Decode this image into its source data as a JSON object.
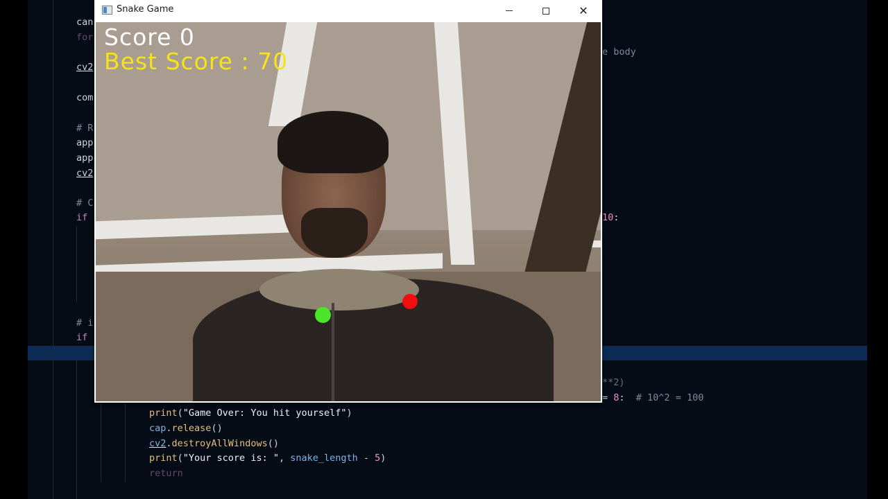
{
  "editor": {
    "lines": [
      {
        "id": "l1",
        "segments": [
          {
            "t": "can",
            "c": "plain"
          }
        ],
        "dim": false
      },
      {
        "id": "l2",
        "segments": [
          {
            "t": "for",
            "c": "kw"
          }
        ],
        "dim": true
      },
      {
        "id": "l3",
        "segments": [
          {
            "t": "e body",
            "c": "cm"
          }
        ],
        "dim": false
      },
      {
        "id": "l4",
        "segments": [
          {
            "t": "cv2",
            "c": "plain"
          }
        ],
        "dim": false
      },
      {
        "id": "l5",
        "segments": [
          {
            "t": "com",
            "c": "plain"
          }
        ],
        "dim": false
      },
      {
        "id": "l6",
        "segments": [
          {
            "t": "# R",
            "c": "cm"
          }
        ],
        "dim": false
      },
      {
        "id": "l7",
        "segments": [
          {
            "t": "app",
            "c": "plain"
          }
        ],
        "dim": false
      },
      {
        "id": "l8",
        "segments": [
          {
            "t": "app",
            "c": "plain"
          }
        ],
        "dim": false
      },
      {
        "id": "l9",
        "segments": [
          {
            "t": "cv2",
            "c": "plain"
          }
        ],
        "dim": false
      },
      {
        "id": "l10",
        "segments": [
          {
            "t": "# C",
            "c": "cm"
          }
        ],
        "dim": false
      },
      {
        "id": "l11",
        "segments": [
          {
            "t": "if",
            "c": "kw"
          }
        ],
        "dim": false
      },
      {
        "id": "l12",
        "segments": [
          {
            "t": "10",
            "c": "num"
          },
          {
            "t": ":",
            "c": "plain"
          }
        ],
        "dim": false
      },
      {
        "id": "l13",
        "segments": [
          {
            "t": "# i",
            "c": "cm"
          }
        ],
        "dim": false
      },
      {
        "id": "l14",
        "segments": [
          {
            "t": "if",
            "c": "kw"
          }
        ],
        "dim": false
      },
      {
        "id": "l15",
        "segments": [
          {
            "t": "**2)",
            "c": "plain"
          }
        ],
        "dim": true
      },
      {
        "id": "l16",
        "segments": [
          {
            "t": "= ",
            "c": "plain"
          },
          {
            "t": "8",
            "c": "num"
          },
          {
            "t": ":  ",
            "c": "plain"
          },
          {
            "t": "# 10^2 = 100",
            "c": "cm"
          }
        ],
        "dim": false
      },
      {
        "id": "l17",
        "segments": [
          {
            "t": "print",
            "c": "fn"
          },
          {
            "t": "(",
            "c": "plain"
          },
          {
            "t": "\"Game Over: You hit yourself\"",
            "c": "str"
          },
          {
            "t": ")",
            "c": "plain"
          }
        ],
        "dim": false
      },
      {
        "id": "l18",
        "segments": [
          {
            "t": "cap",
            "c": "obj"
          },
          {
            "t": ".",
            "c": "plain"
          },
          {
            "t": "release",
            "c": "fn"
          },
          {
            "t": "()",
            "c": "plain"
          }
        ],
        "dim": false
      },
      {
        "id": "l19",
        "segments": [
          {
            "t": "cv2",
            "c": "obj"
          },
          {
            "t": ".",
            "c": "plain"
          },
          {
            "t": "destroyAllWindows",
            "c": "fn"
          },
          {
            "t": "()",
            "c": "plain"
          }
        ],
        "dim": false
      },
      {
        "id": "l20",
        "segments": [
          {
            "t": "print",
            "c": "fn"
          },
          {
            "t": "(",
            "c": "plain"
          },
          {
            "t": "\"Your score is: \"",
            "c": "str"
          },
          {
            "t": ", ",
            "c": "plain"
          },
          {
            "t": "snake_length",
            "c": "obj"
          },
          {
            "t": " - ",
            "c": "plain"
          },
          {
            "t": "5",
            "c": "num"
          },
          {
            "t": ")",
            "c": "plain"
          }
        ],
        "dim": false
      },
      {
        "id": "l21",
        "segments": [
          {
            "t": "return",
            "c": "kw"
          }
        ],
        "dim": true
      }
    ]
  },
  "window": {
    "title": "Snake Game",
    "controls": {
      "minimize": "minimize",
      "maximize": "maximize",
      "close": "✕"
    }
  },
  "game": {
    "score_text": "Score 0",
    "best_score_text": "Best Score : 70"
  },
  "colors": {
    "editor_bg": "#050c16",
    "highlight": "#0d2c55",
    "snake": "#49e62a",
    "food": "#f10e0e",
    "score": "#ffffff",
    "best_score": "#f6e21a"
  }
}
